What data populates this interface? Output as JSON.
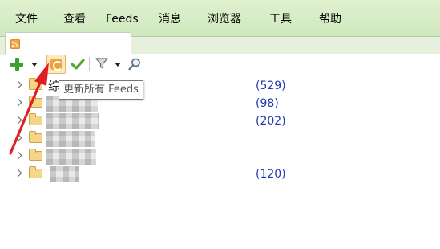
{
  "menu": {
    "items": [
      "文件",
      "查看",
      "Feeds",
      "消息",
      "浏览器",
      "工具",
      "帮助"
    ]
  },
  "toolbar": {
    "tooltip": "更新所有 Feeds",
    "icons": [
      "add-icon",
      "dropdown-arrow-icon",
      "refresh-all-icon",
      "mark-read-check-icon",
      "filter-icon",
      "dropdown-arrow-icon",
      "search-icon"
    ]
  },
  "tree": {
    "rows": [
      {
        "label": "综",
        "count": "(529)"
      },
      {
        "label": "",
        "count": "(98)"
      },
      {
        "label": "",
        "count": "(202)"
      },
      {
        "label": "",
        "count": ""
      },
      {
        "label": "",
        "count": ""
      },
      {
        "label": "",
        "count": "(120)"
      }
    ]
  },
  "colors": {
    "menubar": "#d6edc6",
    "count_text": "#2237b3",
    "annotation_arrow": "#e02020",
    "folder": "#f6d48a"
  }
}
